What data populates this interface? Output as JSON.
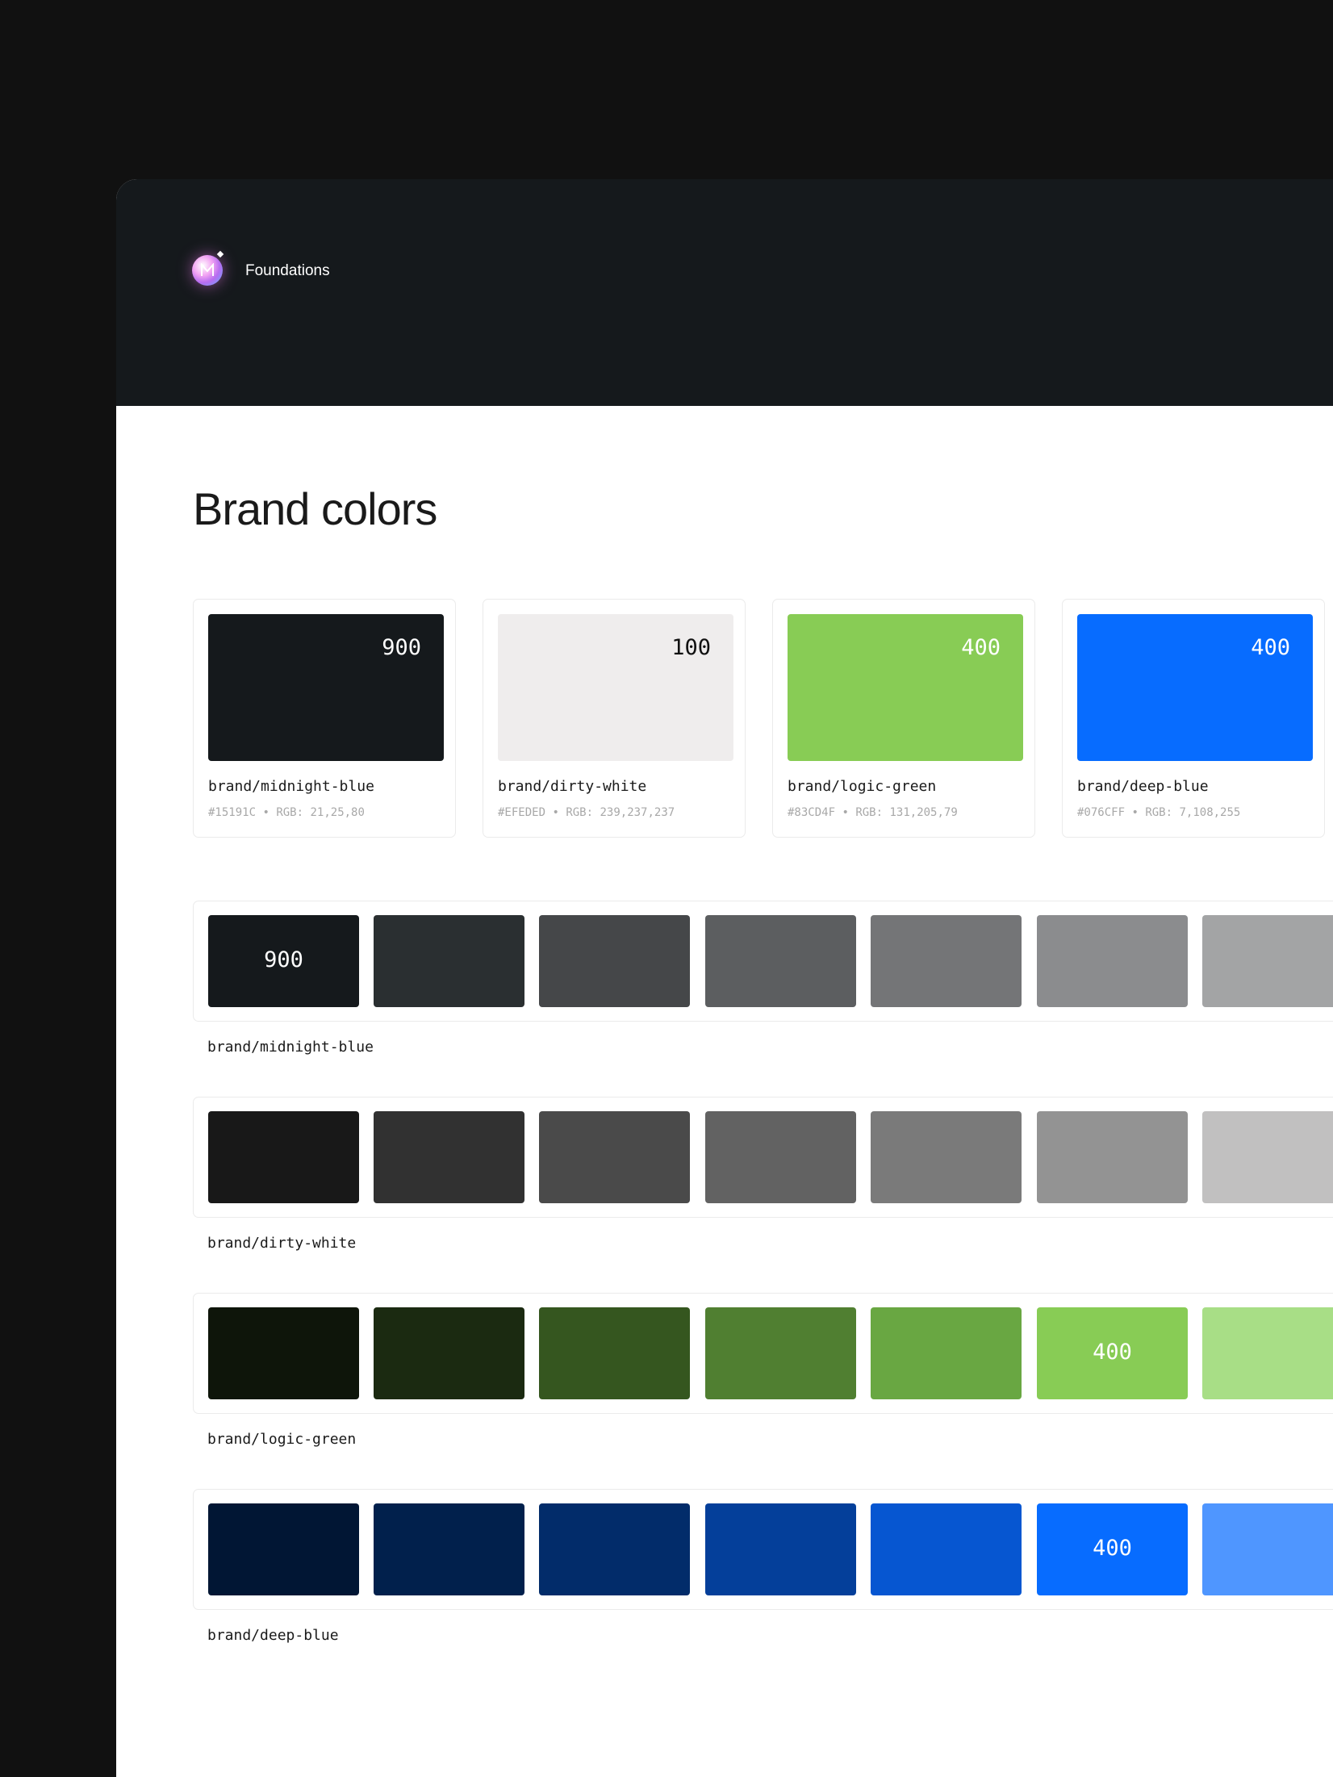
{
  "header": {
    "title": "Foundations"
  },
  "page_title": "Brand colors",
  "cards": [
    {
      "step": "900",
      "name": "brand/midnight-blue",
      "hex": "#15191C",
      "rgb": "21,25,80",
      "color": "#15191c",
      "text_color": "#ffffff"
    },
    {
      "step": "100",
      "name": "brand/dirty-white",
      "hex": "#EFEDED",
      "rgb": "239,237,237",
      "color": "#efeded",
      "text_color": "#111111"
    },
    {
      "step": "400",
      "name": "brand/logic-green",
      "hex": "#83CD4F",
      "rgb": "131,205,79",
      "color": "#88cc55",
      "text_color": "#ffffff"
    },
    {
      "step": "400",
      "name": "brand/deep-blue",
      "hex": "#076CFF",
      "rgb": "7,108,255",
      "color": "#076cff",
      "text_color": "#ffffff"
    }
  ],
  "meta_separator": "•",
  "rgb_prefix": "RGB:",
  "ramps": [
    {
      "name": "brand/midnight-blue",
      "swatches": [
        {
          "color": "#15191c",
          "label": "900"
        },
        {
          "color": "#2a2f31",
          "label": ""
        },
        {
          "color": "#454749",
          "label": ""
        },
        {
          "color": "#5c5e60",
          "label": ""
        },
        {
          "color": "#747577",
          "label": ""
        },
        {
          "color": "#8b8c8e",
          "label": ""
        },
        {
          "color": "#a3a4a5",
          "label": ""
        }
      ]
    },
    {
      "name": "brand/dirty-white",
      "swatches": [
        {
          "color": "#181818",
          "label": ""
        },
        {
          "color": "#313131",
          "label": ""
        },
        {
          "color": "#4a4a4a",
          "label": ""
        },
        {
          "color": "#626262",
          "label": ""
        },
        {
          "color": "#7a7a7a",
          "label": ""
        },
        {
          "color": "#939393",
          "label": ""
        },
        {
          "color": "#c1c0c0",
          "label": ""
        }
      ]
    },
    {
      "name": "brand/logic-green",
      "swatches": [
        {
          "color": "#0e150a",
          "label": ""
        },
        {
          "color": "#1b2a11",
          "label": ""
        },
        {
          "color": "#35561f",
          "label": ""
        },
        {
          "color": "#507f31",
          "label": ""
        },
        {
          "color": "#69a742",
          "label": ""
        },
        {
          "color": "#88cc55",
          "label": "400"
        },
        {
          "color": "#a8de86",
          "label": ""
        }
      ]
    },
    {
      "name": "brand/deep-blue",
      "swatches": [
        {
          "color": "#011634",
          "label": ""
        },
        {
          "color": "#01204c",
          "label": ""
        },
        {
          "color": "#022c6a",
          "label": ""
        },
        {
          "color": "#043f9a",
          "label": ""
        },
        {
          "color": "#0656d1",
          "label": ""
        },
        {
          "color": "#076cff",
          "label": "400"
        },
        {
          "color": "#4f96ff",
          "label": ""
        }
      ]
    }
  ]
}
